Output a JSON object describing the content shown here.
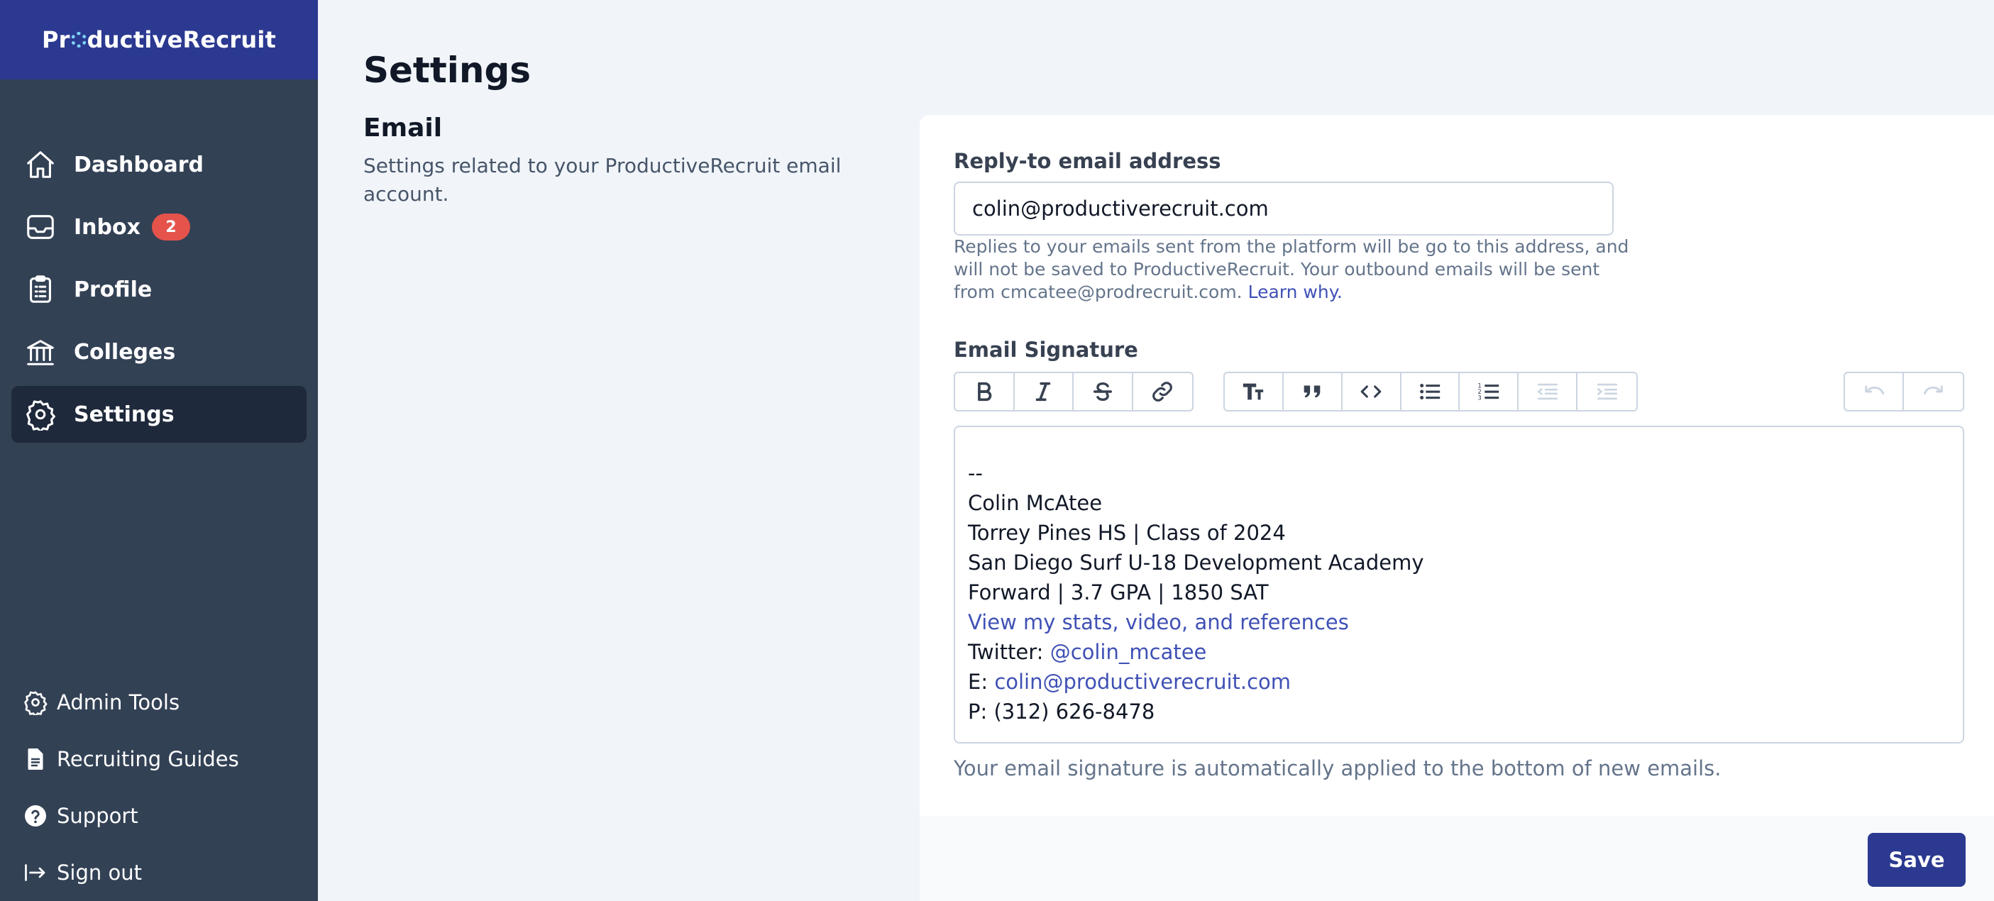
{
  "brand": {
    "pre": "Pr",
    "post": "ductiveRecruit"
  },
  "nav": {
    "dashboard": "Dashboard",
    "inbox": "Inbox",
    "inbox_badge": "2",
    "profile": "Profile",
    "colleges": "Colleges",
    "settings": "Settings"
  },
  "bottom_nav": {
    "admin_tools": "Admin Tools",
    "recruiting_guides": "Recruiting Guides",
    "support": "Support",
    "sign_out": "Sign out"
  },
  "page": {
    "title": "Settings",
    "section_title": "Email",
    "section_desc": "Settings related to your ProductiveRecruit email account."
  },
  "reply_to": {
    "label": "Reply-to email address",
    "value": "colin@productiverecruit.com",
    "help": "Replies to your emails sent from the platform will be go to this address, and will not be saved to ProductiveRecruit. Your outbound emails will be sent from cmcatee@prodrecruit.com.",
    "learn_link": "Learn why."
  },
  "signature": {
    "label": "Email Signature",
    "separator": "--",
    "name": "Colin McAtee",
    "school": "Torrey Pines HS | Class of 2024",
    "club": "San Diego Surf U-18 Development Academy",
    "stats": "Forward | 3.7 GPA | 1850 SAT",
    "profile_link": "View my stats, video, and references",
    "twitter_prefix": "Twitter: ",
    "twitter_handle": "@colin_mcatee",
    "email_prefix": "E: ",
    "email": "colin@productiverecruit.com",
    "phone": "P: (312) 626-8478",
    "help": "Your email signature is automatically applied to the bottom of new emails."
  },
  "toolbar": {
    "icons": [
      "bold-icon",
      "italic-icon",
      "strikethrough-icon",
      "link-icon",
      "heading-icon",
      "quote-icon",
      "code-icon",
      "bullet-list-icon",
      "numbered-list-icon",
      "outdent-icon",
      "indent-icon",
      "undo-icon",
      "redo-icon"
    ]
  },
  "actions": {
    "save": "Save"
  },
  "colors": {
    "brand": "#2b3990",
    "sidebar": "#334155",
    "sidebar_active": "#1e293b",
    "badge": "#e5534b",
    "link": "#3f51b5"
  }
}
